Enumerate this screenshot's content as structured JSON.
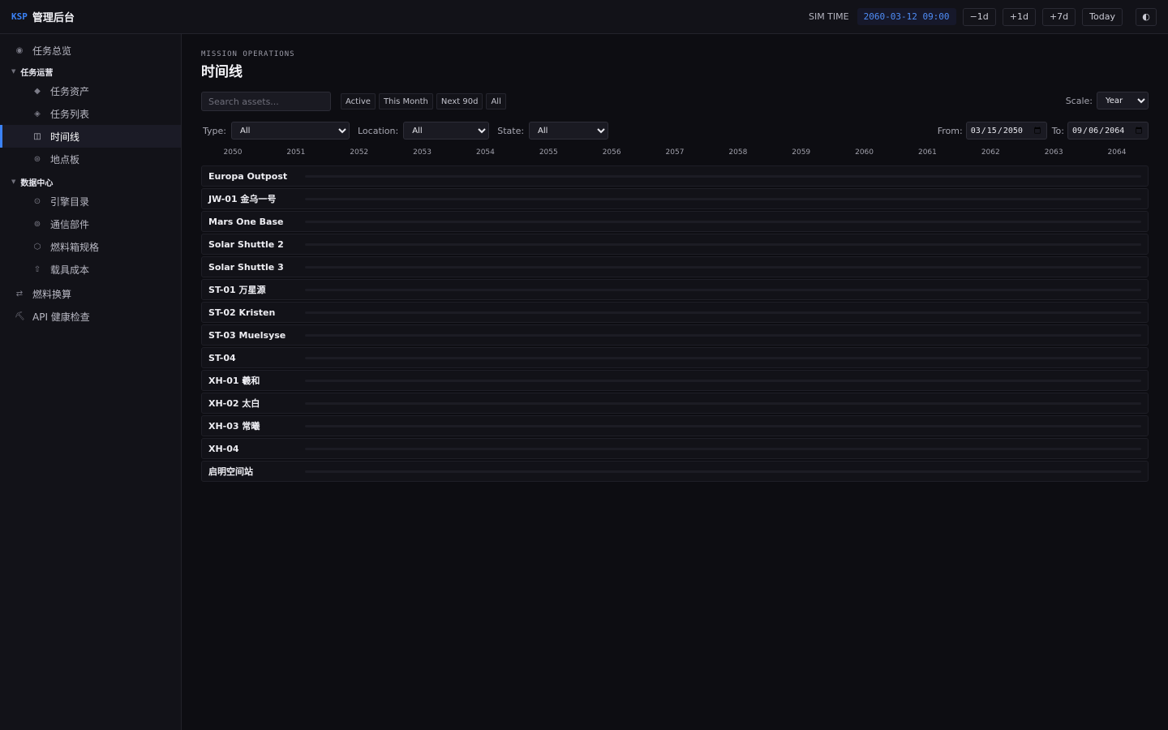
{
  "app": {
    "brand_mark": "KSP",
    "title": "管理后台"
  },
  "topbar": {
    "sim_label": "SIM TIME",
    "sim_time": "2060-03-12 09:00",
    "buttons": [
      "−1d",
      "+1d",
      "+7d",
      "Today"
    ],
    "theme_icon": "◐"
  },
  "sidebar": {
    "overview": {
      "icon": "◉",
      "label": "任务总览"
    },
    "group1": {
      "title": "任务运营",
      "items": [
        {
          "icon": "◆",
          "label": "任务资产"
        },
        {
          "icon": "◈",
          "label": "任务列表"
        },
        {
          "icon": "◫",
          "label": "时间线",
          "active": true
        },
        {
          "icon": "⊛",
          "label": "地点板"
        }
      ]
    },
    "group2": {
      "title": "数据中心",
      "items": [
        {
          "icon": "⊙",
          "label": "引擎目录"
        },
        {
          "icon": "⊚",
          "label": "通信部件"
        },
        {
          "icon": "⬡",
          "label": "燃料箱规格"
        },
        {
          "icon": "⇧",
          "label": "载具成本"
        }
      ]
    },
    "fuel_calc": {
      "icon": "⇄",
      "label": "燃料换算"
    },
    "api_health": {
      "icon": "⛏",
      "label": "API 健康检查"
    }
  },
  "page": {
    "eyebrow": "MISSION OPERATIONS",
    "title": "时间线",
    "search_placeholder": "Search assets...",
    "chips": [
      "Active",
      "This Month",
      "Next 90d",
      "All"
    ],
    "scale_label": "Scale:",
    "scale_value": "Year",
    "type_label": "Type:",
    "type_value": "All",
    "location_label": "Location:",
    "location_value": "All",
    "state_label": "State:",
    "state_value": "All",
    "from_label": "From:",
    "from_value": "2050-03-15",
    "to_label": "To:",
    "to_value": "2064-09-06"
  },
  "timeline": {
    "years": [
      "2050",
      "2051",
      "2052",
      "2053",
      "2054",
      "2055",
      "2056",
      "2057",
      "2058",
      "2059",
      "2060",
      "2061",
      "2062",
      "2063",
      "2064"
    ],
    "rows": [
      "Europa Outpost",
      "JW-01 金乌一号",
      "Mars One Base",
      "Solar Shuttle 2",
      "Solar Shuttle 3",
      "ST-01 万星源",
      "ST-02 Kristen",
      "ST-03 Muelsyse",
      "ST-04",
      "XH-01 羲和",
      "XH-02 太白",
      "XH-03 常曦",
      "XH-04",
      "启明空间站"
    ]
  }
}
